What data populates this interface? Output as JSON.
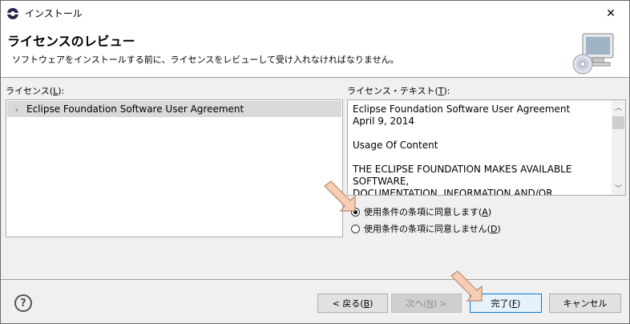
{
  "window": {
    "title": "インストール",
    "close_glyph": "✕"
  },
  "banner": {
    "title": "ライセンスのレビュー",
    "description": "ソフトウェアをインストールする前に、ライセンスをレビューして受け入れなければなりません。"
  },
  "licenses": {
    "label": "ライセンス(",
    "mnemonic": "L",
    "label_end": "):",
    "items": [
      {
        "label": "Eclipse Foundation Software User Agreement",
        "expander": "›"
      }
    ]
  },
  "license_text": {
    "label": "ライセンス・テキスト(",
    "mnemonic": "T",
    "label_end": "):",
    "content": "Eclipse Foundation Software User Agreement\nApril 9, 2014\n\nUsage Of Content\n\nTHE ECLIPSE FOUNDATION MAKES AVAILABLE SOFTWARE,\nDOCUMENTATION, INFORMATION AND/OR",
    "scroll_up": "︿",
    "scroll_down": "﹀"
  },
  "agreement": {
    "accept_label": "使用条件の条項に同意します(",
    "accept_mnemonic": "A",
    "accept_end": ")",
    "accept_selected": true,
    "decline_label": "使用条件の条項に同意しません(",
    "decline_mnemonic": "D",
    "decline_end": ")",
    "decline_selected": false
  },
  "footer": {
    "help": "?",
    "back": {
      "label": "< 戻る(",
      "mnemonic": "B",
      "end": ")"
    },
    "next": {
      "label": "次へ(",
      "mnemonic": "N",
      "end": ") >"
    },
    "finish": {
      "label": "完了(",
      "mnemonic": "F",
      "end": ")"
    },
    "cancel": {
      "label": "キャンセル"
    }
  },
  "colors": {
    "selection_bg": "#d9d9d9",
    "default_button_border": "#0078d7",
    "pointer_fill": "#f7cdb4",
    "pointer_stroke": "#b8896e"
  }
}
